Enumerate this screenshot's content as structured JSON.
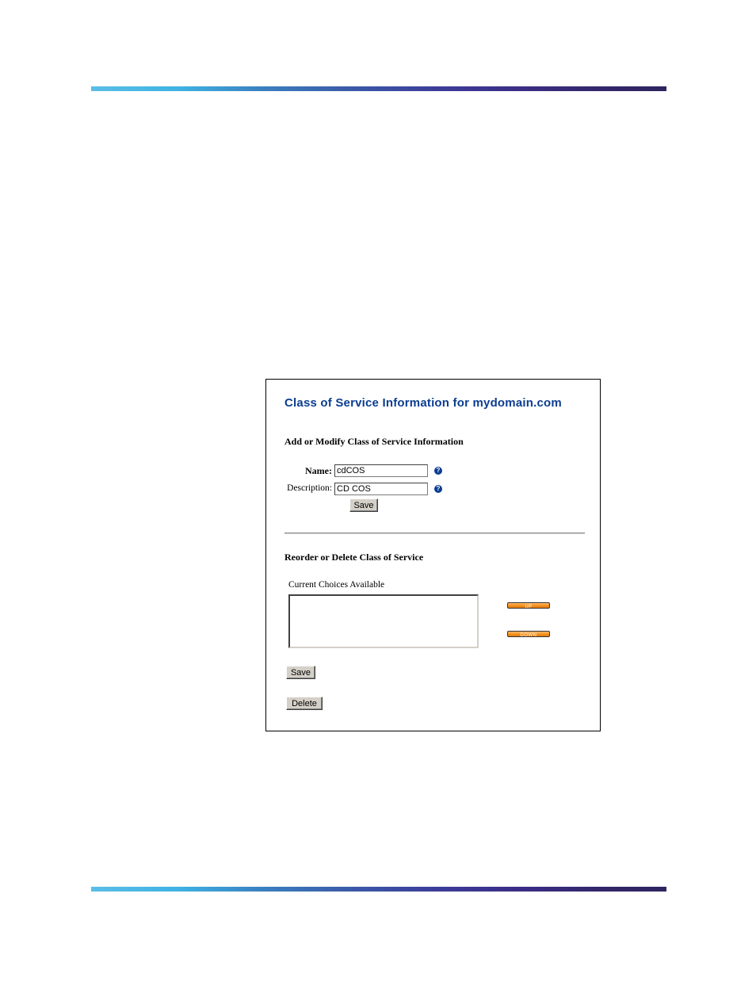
{
  "page": {
    "title": "Class of Service Information for mydomain.com",
    "section_add_modify": "Add or Modify Class of Service Information",
    "section_reorder_delete": "Reorder or Delete Class of Service"
  },
  "form": {
    "name_label": "Name:",
    "name_value": "cdCOS",
    "description_label": "Description:",
    "description_value": "CD COS",
    "help_icon_glyph": "?",
    "save_label": "Save"
  },
  "reorder": {
    "list_label": "Current Choices Available",
    "list_items": [],
    "up_label": "UP",
    "down_label": "DOWN",
    "save_label": "Save",
    "delete_label": "Delete"
  },
  "colors": {
    "title": "#0b3d91",
    "orange_button": "#f7941d"
  }
}
